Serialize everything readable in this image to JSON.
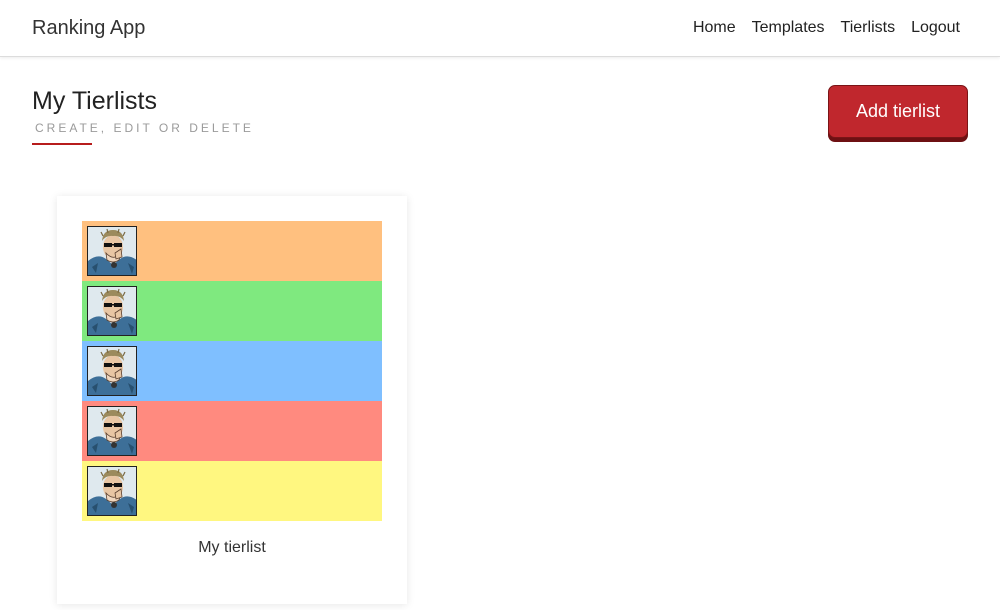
{
  "navbar": {
    "brand": "Ranking App",
    "links": [
      "Home",
      "Templates",
      "Tierlists",
      "Logout"
    ]
  },
  "header": {
    "title": "My Tierlists",
    "subtitle": "CREATE, EDIT OR DELETE",
    "add_button_label": "Add tierlist",
    "accent_color": "#c0272d"
  },
  "tierlists": [
    {
      "title": "My tierlist",
      "tiers": [
        {
          "color": "#ffc07f",
          "items": [
            "character-thumbnail"
          ]
        },
        {
          "color": "#7fe97f",
          "items": [
            "character-thumbnail"
          ]
        },
        {
          "color": "#7fbfff",
          "items": [
            "character-thumbnail"
          ]
        },
        {
          "color": "#ff8a7f",
          "items": [
            "character-thumbnail"
          ]
        },
        {
          "color": "#fff780",
          "items": [
            "character-thumbnail"
          ]
        }
      ]
    }
  ]
}
